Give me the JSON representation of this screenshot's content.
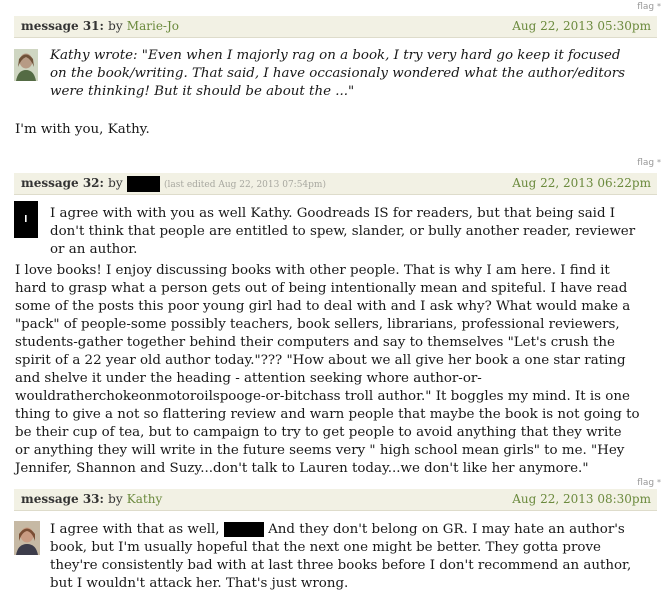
{
  "messages": [
    {
      "flag": "flag",
      "label": "message 31:",
      "by": "by",
      "author": "Marie-Jo",
      "date": "Aug 22, 2013 05:30pm",
      "quote": "Kathy wrote: \"Even when I majorly rag on a book, I try very hard go keep it focused on the book/writing. That said, I have occasionaly wondered what the author/editors were thinking! But it should be about the ...\"",
      "body": "I'm with you, Kathy."
    },
    {
      "flag": "flag",
      "label": "message 32:",
      "by": "by",
      "edited": "(last edited Aug 22, 2013 07:54pm)",
      "date": "Aug 22, 2013 06:22pm",
      "p1": "I agree with with you as well Kathy. Goodreads IS for readers, but that being said I don't think that people are entitled to spew, slander, or bully another reader, reviewer or an author.",
      "p2": "I love books! I enjoy discussing books with other people. That is why I am here. I find it hard to grasp what a person gets out of being intentionally mean and spiteful. I have read some of the posts this poor young girl had to deal with and I ask why? What would make a \"pack\" of people-some possibly teachers, book sellers, librarians, professional reviewers, students-gather together behind their computers and say to themselves \"Let's crush the spirit of a 22 year old author today.\"??? \"How about we all give her book a one star rating and shelve it under the heading - attention seeking whore author-or-wouldratherchokeonmotoroilspooge-or-bitchass troll author.\" It boggles my mind. It is one thing to give a not so flattering review and warn people that maybe the book is not going to be their cup of tea, but to campaign to try to get people to avoid anything that they write or anything they will write in the future seems very \" high school mean girls\" to me. \"Hey Jennifer, Shannon and Suzy...don't talk to Lauren today...we don't like her anymore.\""
    },
    {
      "flag": "flag",
      "label": "message 33:",
      "by": "by",
      "author": "Kathy",
      "date": "Aug 22, 2013 08:30pm",
      "body_a": "I agree with that as well,",
      "body_b": "And they don't belong on GR. I may hate an author's book, but I'm usually hopeful that the next one might be better. They gotta prove they're consistently bad with at last three books before I don't recommend an author, but I wouldn't attack her. That's just wrong."
    }
  ]
}
